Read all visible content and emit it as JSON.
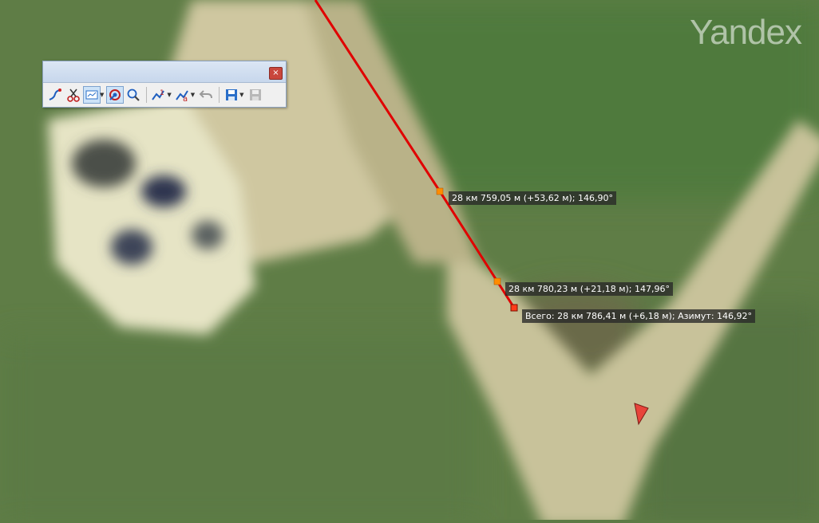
{
  "map": {
    "watermark": "Yandex",
    "route_color": "#e00000",
    "vertex_color": "#ff8c00",
    "labels": {
      "segment_1": "28 км 759,05 м (+53,62 м); 146,90°",
      "segment_2": "28 км 780,23 м (+21,18 м); 147,96°",
      "total": "Всего: 28 км 786,41 м (+6,18 м); Азимут: 146,92°"
    }
  },
  "toolbar": {
    "close_symbol": "×",
    "tools": [
      {
        "name": "draw-path-tool-icon"
      },
      {
        "name": "cut-tool-icon"
      },
      {
        "name": "view-mode-icon"
      },
      {
        "name": "measure-tool-icon"
      },
      {
        "name": "zoom-search-icon"
      },
      {
        "name": "elevation-profile-icon"
      },
      {
        "name": "label-tool-icon"
      },
      {
        "name": "undo-icon"
      },
      {
        "name": "save-icon"
      },
      {
        "name": "save-all-icon"
      }
    ]
  }
}
